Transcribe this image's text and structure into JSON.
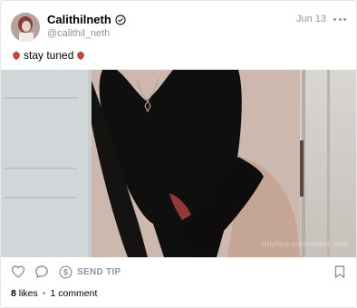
{
  "post": {
    "author": "Calithilneth",
    "handle": "@calithil_neth",
    "date": "Jun 13",
    "caption": "stay tuned",
    "watermark": "onlyfans.com/calithil_neth"
  },
  "actions": {
    "send_tip": "SEND TIP"
  },
  "stats": {
    "likes_count": "8",
    "likes_label": "likes",
    "separator": "•",
    "comments": "1 comment"
  },
  "icons": {
    "verified": "verified-check-icon",
    "more": "more-dots-icon",
    "like": "heart-icon",
    "comment": "comment-bubble-icon",
    "tip": "dollar-circle-icon",
    "bookmark": "bookmark-icon",
    "emoji": "strawberry-emoji"
  },
  "colors": {
    "muted": "#8a96a3",
    "border": "#e6e6ea",
    "text": "#000000"
  }
}
